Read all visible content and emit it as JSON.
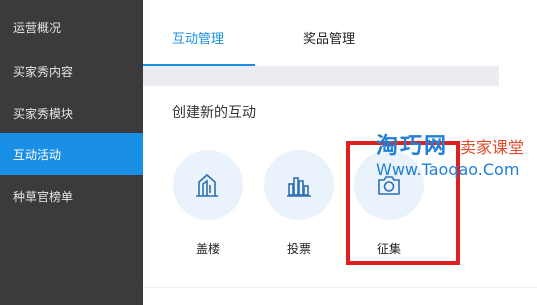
{
  "sidebar": {
    "items": [
      {
        "label": "运营概况",
        "active": false
      },
      {
        "label": "买家秀内容",
        "active": false
      },
      {
        "label": "买家秀模块",
        "active": false
      },
      {
        "label": "互动活动",
        "active": true
      },
      {
        "label": "种草官榜单",
        "active": false
      }
    ]
  },
  "tabs": [
    {
      "label": "互动管理",
      "active": true
    },
    {
      "label": "奖品管理",
      "active": false
    }
  ],
  "section": {
    "title": "创建新的互动"
  },
  "cards": [
    {
      "label": "盖楼",
      "icon": "building-icon"
    },
    {
      "label": "投票",
      "icon": "bar-chart-icon"
    },
    {
      "label": "征集",
      "icon": "camera-icon"
    }
  ],
  "watermark": {
    "brand": "淘巧网",
    "subtitle": "卖家课堂",
    "url": "Www.Taoqao.Com"
  },
  "colors": {
    "accent": "#1a8fe6",
    "sidebar_bg": "#3b3b3b",
    "highlight": "#e02020"
  }
}
